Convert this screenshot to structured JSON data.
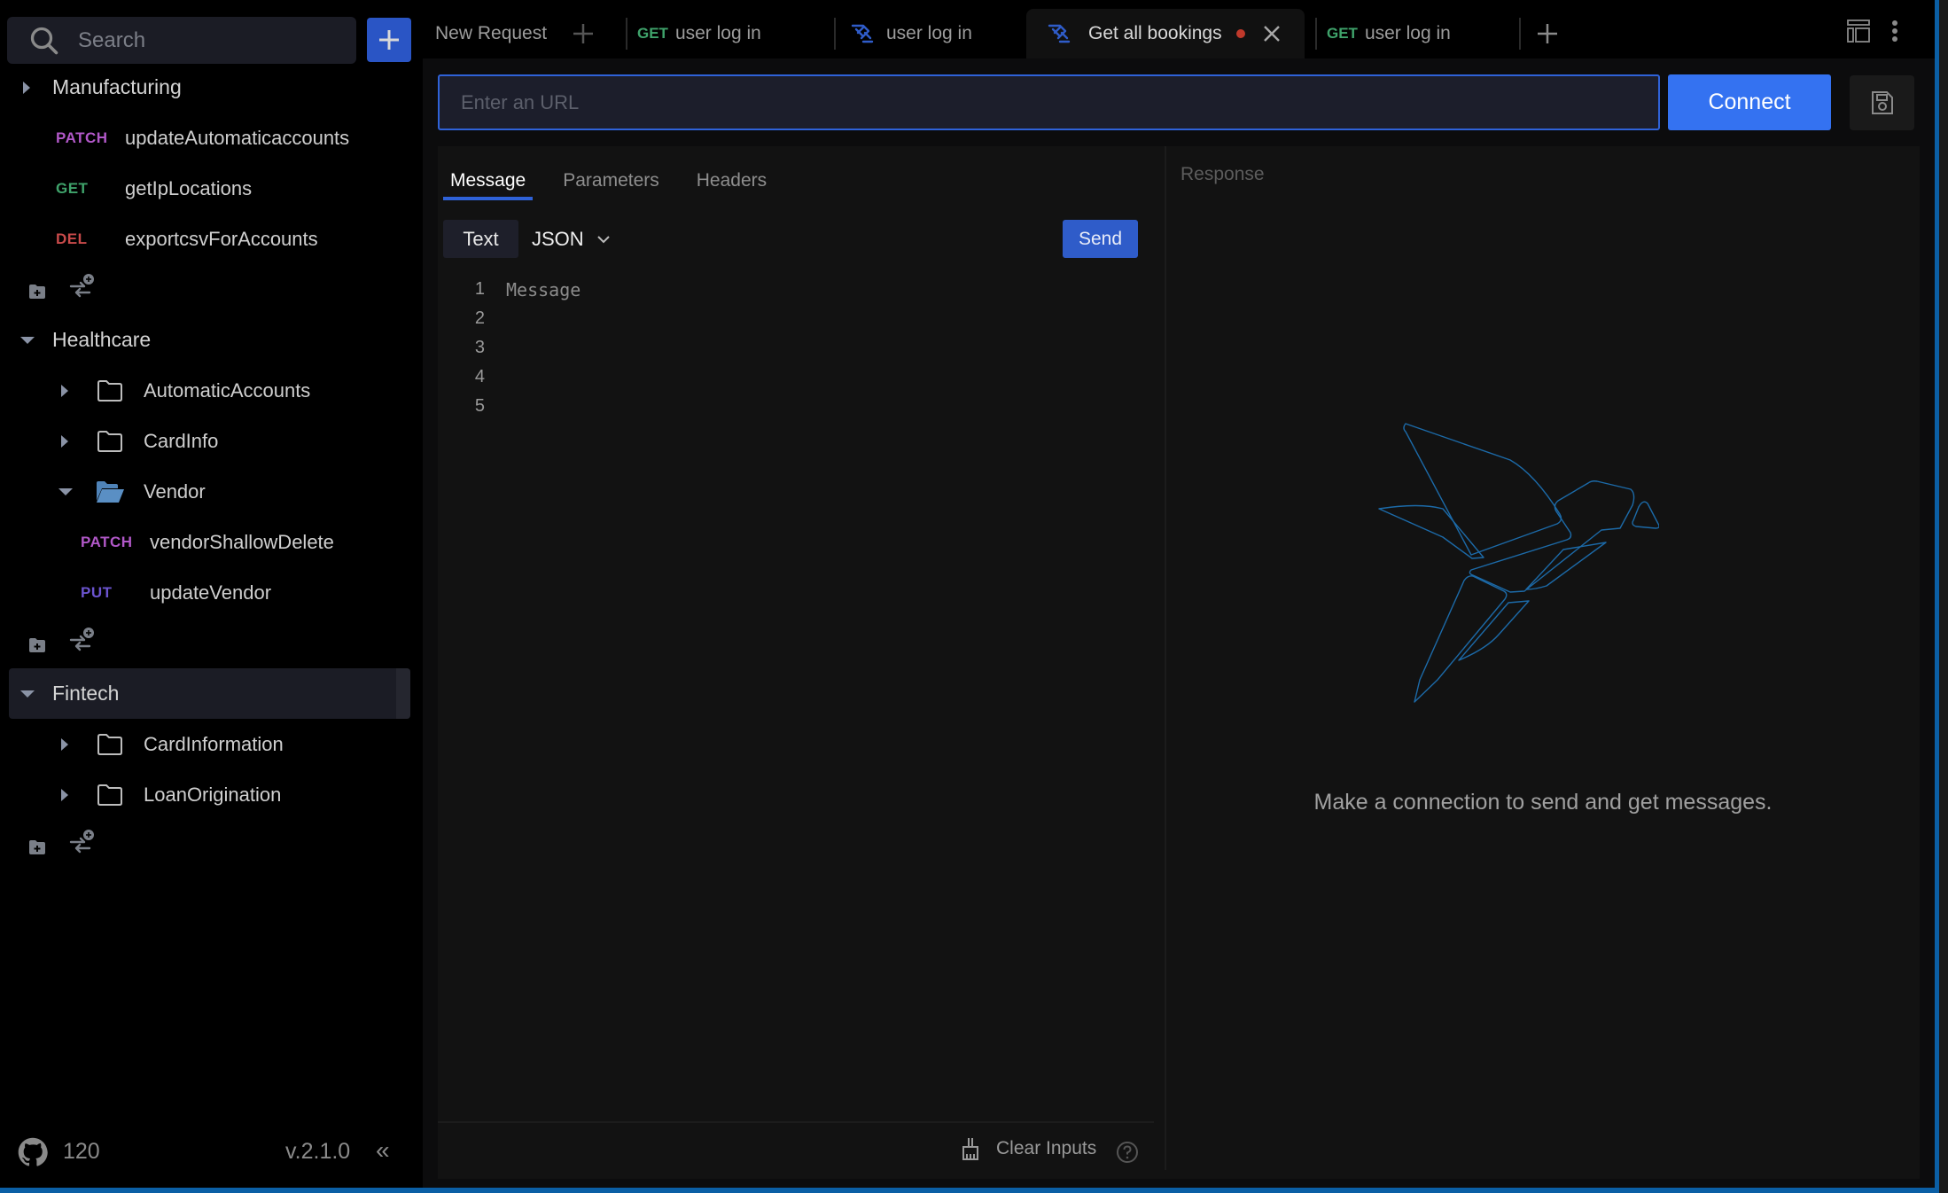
{
  "sidebar": {
    "search_placeholder": "Search",
    "add_button_label": "+",
    "collections": [
      {
        "name": "Manufacturing",
        "expanded": false,
        "requests": [
          {
            "method": "PATCH",
            "name": "updateAutomaticaccounts"
          },
          {
            "method": "GET",
            "name": "getIpLocations"
          },
          {
            "method": "DEL",
            "name": "exportcsvForAccounts"
          }
        ]
      },
      {
        "name": "Healthcare",
        "expanded": true,
        "folders": [
          {
            "name": "AutomaticAccounts",
            "expanded": false
          },
          {
            "name": "CardInfo",
            "expanded": false
          },
          {
            "name": "Vendor",
            "expanded": true,
            "requests": [
              {
                "method": "PATCH",
                "name": "vendorShallowDelete"
              },
              {
                "method": "PUT",
                "name": "updateVendor"
              }
            ]
          }
        ]
      },
      {
        "name": "Fintech",
        "expanded": true,
        "selected": true,
        "folders": [
          {
            "name": "CardInformation",
            "expanded": false
          },
          {
            "name": "LoanOrigination",
            "expanded": false
          }
        ]
      }
    ],
    "footer": {
      "github_stars": "120",
      "version": "v.2.1.0",
      "collapse_glyph": "«"
    }
  },
  "tabs": [
    {
      "label": "New Request",
      "type": "new",
      "active": false
    },
    {
      "label": "user log in",
      "method": "GET",
      "type": "http",
      "active": false
    },
    {
      "label": "user log in",
      "type": "websocket",
      "active": false
    },
    {
      "label": "Get all bookings",
      "type": "websocket",
      "active": true,
      "unsaved": true
    },
    {
      "label": "user log in",
      "method": "GET",
      "type": "http",
      "active": false
    }
  ],
  "url_bar": {
    "placeholder": "Enter an URL",
    "value": "",
    "connect_label": "Connect"
  },
  "request": {
    "tabs": [
      "Message",
      "Parameters",
      "Headers"
    ],
    "active_tab": "Message",
    "format_text_label": "Text",
    "format_select_value": "JSON",
    "send_label": "Send",
    "editor": {
      "line_numbers": [
        "1",
        "2",
        "3",
        "4",
        "5"
      ],
      "placeholder": "Message"
    },
    "clear_inputs_label": "Clear Inputs"
  },
  "response": {
    "label": "Response",
    "empty_message": "Make a connection to send and get messages."
  },
  "colors": {
    "accent": "#3472f1",
    "patch": "#b158c8",
    "get": "#3fa36b",
    "del": "#c94a4a",
    "put": "#6b54cf",
    "unsaved_dot": "#c0392b",
    "frame_border": "#0b5fa5"
  }
}
